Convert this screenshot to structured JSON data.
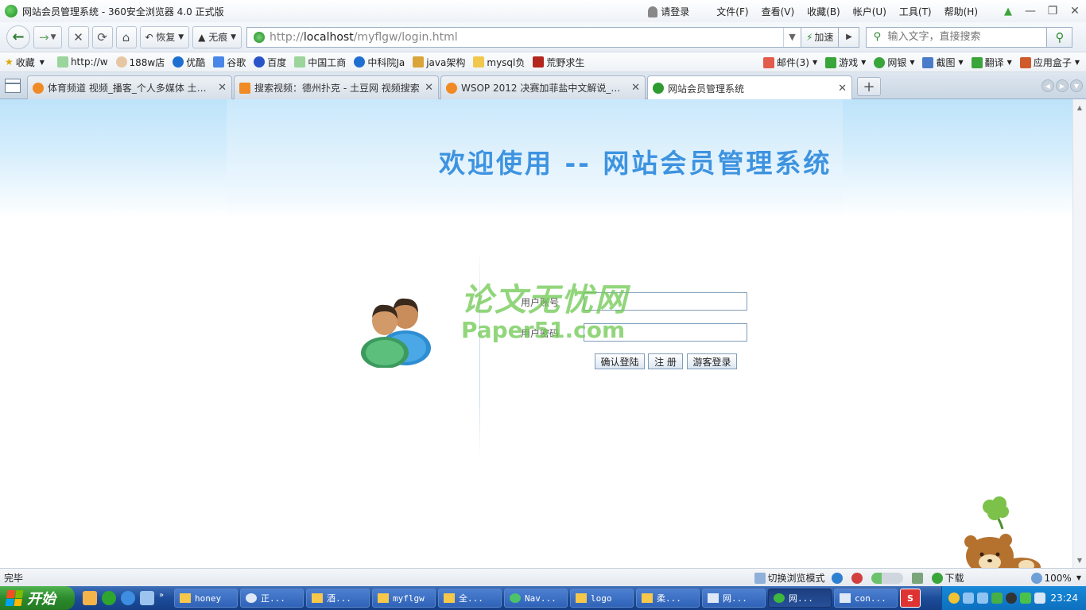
{
  "window": {
    "title": "网站会员管理系统 - 360安全浏览器 4.0 正式版",
    "login": "请登录",
    "menus": [
      "文件(F)",
      "查看(V)",
      "收藏(B)",
      "帐户(U)",
      "工具(T)",
      "帮助(H)"
    ]
  },
  "toolbar": {
    "back_icon": "back-arrow-icon",
    "restore_label": "恢复",
    "incognito_label": "无痕",
    "url_prefix": "http://",
    "url_host": "localhost",
    "url_path": "/myflgw/login.html",
    "accelerate_label": "加速",
    "search_placeholder": "输入文字，直接搜索"
  },
  "favorites": {
    "items": [
      "收藏",
      "http://w",
      "188w店",
      "优酷",
      "谷歌",
      "百度",
      "中国工商",
      "中科院Ja",
      "java架构",
      "mysql负",
      "荒野求生"
    ],
    "right_items": [
      "邮件(3)",
      "游戏",
      "网银",
      "截图",
      "翻译",
      "应用盒子"
    ]
  },
  "tabs": [
    {
      "label": "体育频道 视频_播客_个人多媒体 土豆网",
      "icon_color": "#f08a24"
    },
    {
      "label": "搜索视频：德州扑克 - 土豆网 视频搜索",
      "icon_color": "#f08a24"
    },
    {
      "label": "WSOP 2012 决赛加菲盐中文解说_视频",
      "icon_color": "#f08a24"
    },
    {
      "label": "网站会员管理系统",
      "icon_color": "#2e9b2e"
    }
  ],
  "page": {
    "heading": "欢迎使用 -- 网站会员管理系统",
    "username_label": "用户账号",
    "password_label": "用户密码",
    "login_button": "确认登陆",
    "register_button": "注 册",
    "guest_button": "游客登录",
    "watermark_line1": "论文无忧网",
    "watermark_line2": "Paper51.com",
    "heading_color": "#3d93e0"
  },
  "statusbar": {
    "status": "完毕",
    "switch_mode": "切换浏览模式",
    "download": "下载",
    "zoom": "100%"
  },
  "taskbar": {
    "start": "开始",
    "tasks": [
      "honey",
      "正...",
      "酒...",
      "myflgw",
      "全...",
      "Nav...",
      "logo",
      "柔...",
      "网...",
      "网...",
      "con..."
    ],
    "clock": "23:24"
  }
}
